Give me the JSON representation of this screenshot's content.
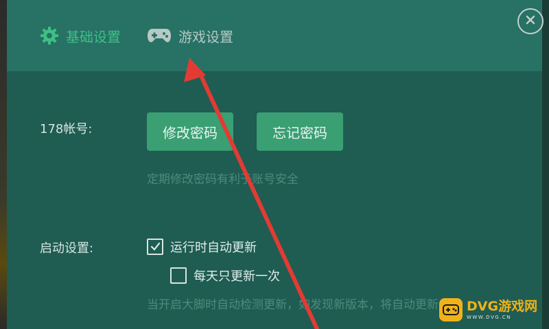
{
  "tabs": [
    {
      "label": "基础设置",
      "icon": "gear-icon",
      "active": true
    },
    {
      "label": "游戏设置",
      "icon": "gamepad-icon",
      "active": false
    }
  ],
  "account": {
    "label": "178帐号:",
    "change_password": "修改密码",
    "forgot_password": "忘记密码",
    "hint": "定期修改密码有利于账号安全"
  },
  "startup": {
    "label": "启动设置:",
    "options": [
      {
        "label": "运行时自动更新",
        "checked": true
      },
      {
        "label": "每天只更新一次",
        "checked": false
      }
    ],
    "hint": "当开启大脚时自动检测更新，如发现新版本，将自动更新"
  },
  "watermark": {
    "title": "DVG游戏网",
    "sub": "WWW.DVG.CN"
  },
  "colors": {
    "accent": "#3a9f73",
    "arrow": "#e23b34"
  }
}
